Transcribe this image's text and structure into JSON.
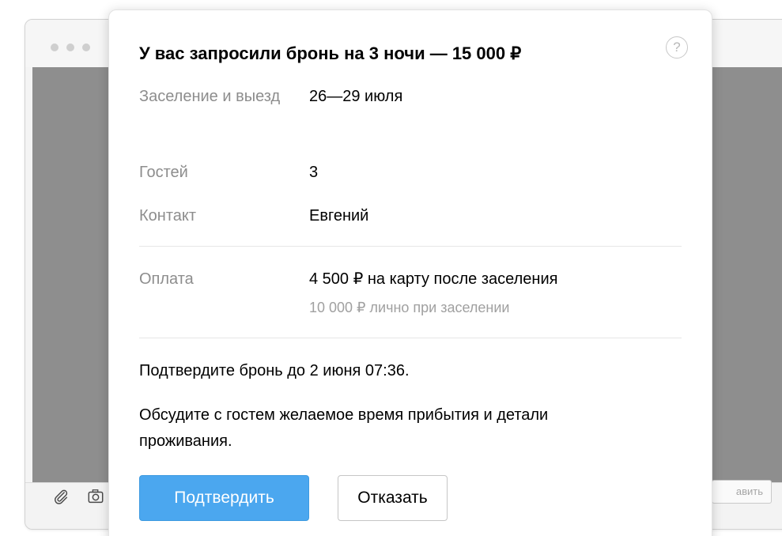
{
  "background": {
    "send_label": "авить"
  },
  "booking": {
    "title": "У вас запросили бронь на 3 ночи — 15 000 ₽",
    "help_label": "?",
    "rows": [
      {
        "label": "Заселение и выезд",
        "value": "26—29 июля"
      },
      {
        "label": "Гостей",
        "value": "3"
      },
      {
        "label": "Контакт",
        "value": "Евгений"
      }
    ],
    "payment": {
      "label": "Оплата",
      "value": "4 500 ₽ на карту после заселения",
      "sub": "10 000 ₽ лично при заселении"
    },
    "deadline_text": "Подтвердите бронь до 2 июня 07:36.",
    "discuss_text": "Обсудите с гостем желаемое время прибытия и детали проживания.",
    "confirm_label": "Подтвердить",
    "decline_label": "Отказать"
  },
  "colors": {
    "accent": "#4ba7ef",
    "label_gray": "#8d8d8d",
    "overlay": "#8e8e8e"
  }
}
